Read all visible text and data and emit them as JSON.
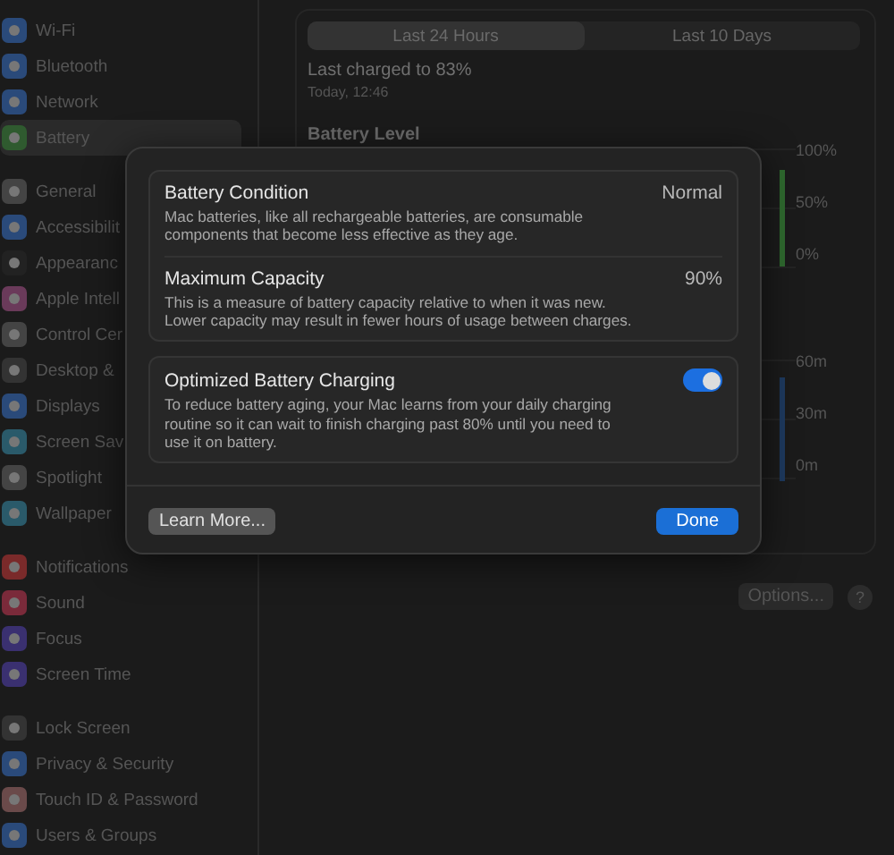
{
  "sidebar": {
    "groups": [
      {
        "items": [
          {
            "label": "Wi-Fi",
            "selected": false
          },
          {
            "label": "Bluetooth",
            "selected": false
          },
          {
            "label": "Network",
            "selected": false
          },
          {
            "label": "Battery",
            "selected": true
          }
        ]
      },
      {
        "items": [
          {
            "label": "General",
            "selected": false
          },
          {
            "label": "Accessibilit",
            "selected": false
          },
          {
            "label": "Appearanc",
            "selected": false
          },
          {
            "label": "Apple Intell",
            "selected": false
          },
          {
            "label": "Control Cer",
            "selected": false
          },
          {
            "label": "Desktop &",
            "selected": false
          },
          {
            "label": "Displays",
            "selected": false
          },
          {
            "label": "Screen Sav",
            "selected": false
          },
          {
            "label": "Spotlight",
            "selected": false
          },
          {
            "label": "Wallpaper",
            "selected": false
          }
        ]
      },
      {
        "items": [
          {
            "label": "Notifications",
            "selected": false
          },
          {
            "label": "Sound",
            "selected": false
          },
          {
            "label": "Focus",
            "selected": false
          },
          {
            "label": "Screen Time",
            "selected": false
          }
        ]
      },
      {
        "items": [
          {
            "label": "Lock Screen",
            "selected": false
          },
          {
            "label": "Privacy & Security",
            "selected": false
          },
          {
            "label": "Touch ID & Password",
            "selected": false
          },
          {
            "label": "Users & Groups",
            "selected": false
          }
        ]
      }
    ]
  },
  "battery": {
    "tabs": [
      {
        "label": "Last 24 Hours",
        "selected": true
      },
      {
        "label": "Last 10 Days",
        "selected": false
      }
    ],
    "last_charged": "Last charged to 83%",
    "last_charged_time": "Today, 12:46",
    "battery_level_title": "Battery Level",
    "level_axis": [
      "100%",
      "50%",
      "0%"
    ],
    "usage_axis": [
      "60m",
      "30m",
      "0m"
    ],
    "options_button": "Options...",
    "help_button": "?"
  },
  "sheet": {
    "rows": [
      {
        "title": "Battery Condition",
        "value": "Normal",
        "description": "Mac batteries, like all rechargeable batteries, are consumable components that become less effective as they age."
      },
      {
        "title": "Maximum Capacity",
        "value": "90%",
        "description": "This is a measure of battery capacity relative to when it was new. Lower capacity may result in fewer hours of usage between charges."
      }
    ],
    "optimized": {
      "title": "Optimized Battery Charging",
      "description": "To reduce battery aging, your Mac learns from your daily charging routine so it can wait to finish charging past 80% until you need to use it on battery.",
      "on": true
    },
    "learn_more": "Learn More...",
    "done": "Done"
  }
}
